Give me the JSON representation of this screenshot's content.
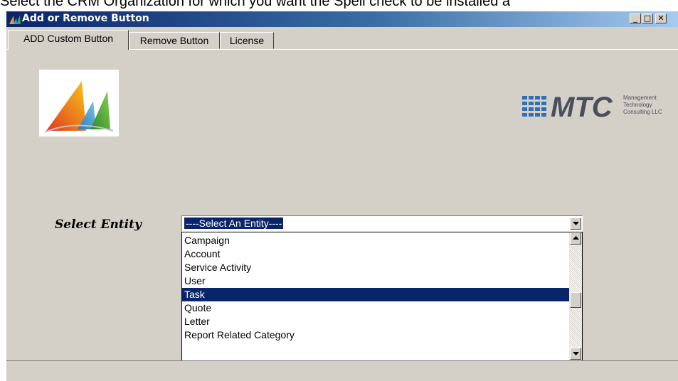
{
  "caption": {
    "text": "Select the CRM Organization for which you want the Spell check to be installed a"
  },
  "window": {
    "title": "Add or Remove Button",
    "minimize_glyph": "_",
    "maximize_glyph": "□",
    "close_glyph": "✕"
  },
  "tabs": [
    {
      "label": "ADD Custom Button",
      "active": true
    },
    {
      "label": "Remove Button",
      "active": false
    },
    {
      "label": "License",
      "active": false
    }
  ],
  "logo": {
    "mtc_text": "MTC",
    "mtc_tagline": [
      "Management",
      "Technology",
      "Consulting LLC"
    ]
  },
  "form": {
    "entity_label": "Select Entity",
    "selected_value": "----Select An Entity----",
    "options": [
      "Campaign",
      "Account",
      "Service Activity",
      "User",
      "Task",
      "Quote",
      "Letter",
      "Report Related Category"
    ],
    "highlighted_option": "Task"
  },
  "icons": {
    "dropdown_arrow": "triangle-down",
    "scroll_up": "triangle-up",
    "scroll_down": "triangle-down"
  },
  "colors": {
    "title_bar": "#0a246a",
    "selection": "#0a246a",
    "window_face": "#d4d0c8"
  }
}
